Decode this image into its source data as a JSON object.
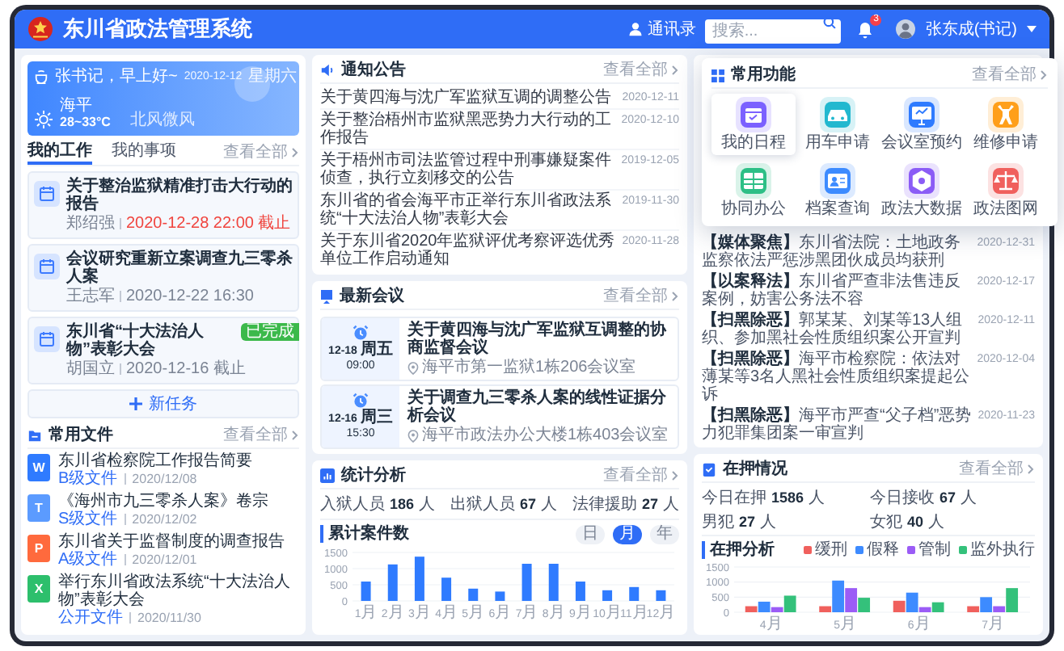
{
  "header": {
    "title": "东川省政法管理系统",
    "contacts": "通讯录",
    "search": {
      "placeholder": "搜索..."
    },
    "notification_count": "3",
    "user": "张东成(书记)"
  },
  "greeting": {
    "text": "张书记，早上好~",
    "city": "海平",
    "temperature": "28~33°C",
    "wind": "北风微风",
    "date": "2020-12-12",
    "weekday": "星期六"
  },
  "work": {
    "tabs": [
      {
        "label": "我的工作",
        "selected": true
      },
      {
        "label": "我的事项",
        "selected": false
      }
    ],
    "view_all": "查看全部",
    "tasks": [
      {
        "title": "关于整治监狱精准打击大行动的报告",
        "person": "郑绍强",
        "time": "2020-12-28 22:00 截止",
        "urgent": true
      },
      {
        "title": "会议研究重新立案调查九三零杀人案",
        "person": "王志军",
        "time": "2020-12-22 16:30",
        "urgent": false
      },
      {
        "title": "东川省“十大法治人物”表彰大会",
        "person": "胡国立",
        "time": "2020-12-16 截止",
        "urgent": false,
        "badge": "已完成"
      }
    ],
    "new_task": "新任务"
  },
  "files": {
    "title": "常用文件",
    "view_all": "查看全部",
    "items": [
      {
        "kind": "word",
        "letter": "W",
        "name": "东川省检察院工作报告简要",
        "grade": "B级文件",
        "date": "2020/12/08"
      },
      {
        "kind": "text",
        "letter": "T",
        "name": "《海州市九三零杀人案》卷宗",
        "grade": "S级文件",
        "date": "2020/12/02"
      },
      {
        "kind": "slides",
        "letter": "P",
        "name": "东川省关于监督制度的调查报告",
        "grade": "A级文件",
        "date": "2020/12/01"
      },
      {
        "kind": "sheet",
        "letter": "X",
        "name": "举行东川省政法系统“十大法治人物”表彰大会",
        "grade": "公开文件",
        "date": "2020/11/30"
      }
    ]
  },
  "notices": {
    "title": "通知公告",
    "view_all": "查看全部",
    "items": [
      {
        "title": "关于黄四海与沈广军监狱互调的调整公告",
        "date": "2020-12-11"
      },
      {
        "title": "关于整治梧州市监狱黑恶势力大行动的工作报告",
        "date": "2020-12-10"
      },
      {
        "title": "关于梧州市司法监管过程中刑事嫌疑案件侦查，执行立刻移交的公告",
        "date": "2019-12-05"
      },
      {
        "title": "东川省的省会海平市正举行东川省政法系统“十大法治人物”表彰大会",
        "date": "2019-11-30"
      },
      {
        "title": "关于东川省2020年监狱评优考察评选优秀单位工作启动通知",
        "date": "2020-11-28"
      }
    ]
  },
  "meetings": {
    "title": "最新会议",
    "view_all": "查看全部",
    "items": [
      {
        "date": "12-18",
        "weekday": "周五",
        "time": "09:00",
        "title": "关于黄四海与沈广军监狱互调整的协商监督会议",
        "location": "海平市第一监狱1栋206会议室"
      },
      {
        "date": "12-16",
        "weekday": "周三",
        "time": "15:30",
        "title": "关于调查九三零杀人案的线性证据分析会议",
        "location": "海平市政法办公大楼1栋403会议室"
      }
    ]
  },
  "stats": {
    "title": "统计分析",
    "view_all": "查看全部",
    "figures": [
      {
        "label": "入狱人员",
        "value": "186",
        "unit": "人"
      },
      {
        "label": "出狱人员",
        "value": "67",
        "unit": "人"
      },
      {
        "label": "法律援助",
        "value": "27",
        "unit": "人"
      }
    ],
    "periods": [
      {
        "label": "日",
        "selected": false
      },
      {
        "label": "月",
        "selected": true
      },
      {
        "label": "年",
        "selected": false
      }
    ],
    "chart_data": {
      "type": "bar",
      "title": "累计案件数",
      "categories": [
        "1月",
        "2月",
        "3月",
        "4月",
        "5月",
        "6月",
        "7月",
        "8月",
        "9月",
        "10月",
        "11月",
        "12月"
      ],
      "series": [
        {
          "color": "#2f7bff",
          "values": [
            600,
            1130,
            1370,
            720,
            380,
            290,
            1150,
            1150,
            600,
            330,
            430,
            330
          ]
        }
      ],
      "ylim": [
        0,
        1500
      ],
      "yticks": [
        0,
        500,
        1000,
        1500
      ]
    }
  },
  "news": {
    "items": [
      {
        "tag": "【媒体聚焦】",
        "title": "东川省法院：土地政务监察依法严惩涉黑团伙成员均获刑",
        "date": "2020-12-31"
      },
      {
        "tag": "【以案释法】",
        "title": "东川省严查非法售违反案例，妨害公务法不容",
        "date": "2020-12-17"
      },
      {
        "tag": "【扫黑除恶】",
        "title": "郭某某、刘某等13人组织、参加黑社会性质组织案公开宣判",
        "date": "2020-12-11"
      },
      {
        "tag": "【扫黑除恶】",
        "title": "海平市检察院：依法对薄某等3名人黑社会性质组织案提起公诉",
        "date": "2020-12-04"
      },
      {
        "tag": "【扫黑除恶】",
        "title": "海平市严查“父子档”恶势力犯罪集团案一审宣判",
        "date": "2020-11-23"
      }
    ]
  },
  "custody": {
    "title": "在押情况",
    "view_all": "查看全部",
    "figures": [
      {
        "label": "今日在押",
        "value": "1586",
        "unit": "人"
      },
      {
        "label": "今日接收",
        "value": "67",
        "unit": "人"
      },
      {
        "label": "男犯",
        "value": "27",
        "unit": "人"
      },
      {
        "label": "女犯",
        "value": "40",
        "unit": "人"
      }
    ],
    "chart_data": {
      "type": "bar",
      "title": "在押分析",
      "categories": [
        "4月",
        "5月",
        "6月",
        "7月"
      ],
      "series": [
        {
          "name": "缓刑",
          "color": "#f0605d",
          "values": [
            200,
            200,
            380,
            200
          ]
        },
        {
          "name": "假释",
          "color": "#3d8bff",
          "values": [
            350,
            1050,
            650,
            500
          ]
        },
        {
          "name": "管制",
          "color": "#9b5cf6",
          "values": [
            170,
            800,
            170,
            200
          ]
        },
        {
          "name": "监外执行",
          "color": "#34c17b",
          "values": [
            550,
            480,
            330,
            800
          ]
        }
      ],
      "ylim": [
        0,
        1500
      ],
      "yticks": [
        0,
        500,
        1000,
        1500
      ]
    }
  },
  "quick_functions": {
    "title": "常用功能",
    "view_all": "查看全部",
    "items": [
      {
        "label": "我的日程",
        "kind": "calendar",
        "color": "#7b61ff",
        "selected": true
      },
      {
        "label": "用车申请",
        "kind": "car",
        "color": "#22b8cf",
        "selected": false
      },
      {
        "label": "会议室预约",
        "kind": "board",
        "color": "#2f7bff",
        "selected": false
      },
      {
        "label": "维修申请",
        "kind": "wrench",
        "color": "#ff9f1a",
        "selected": false
      },
      {
        "label": "协同办公",
        "kind": "sheet",
        "color": "#2dbf86",
        "selected": false
      },
      {
        "label": "档案查询",
        "kind": "card",
        "color": "#3d8bff",
        "selected": false
      },
      {
        "label": "政法大数据",
        "kind": "hexagon",
        "color": "#8b5cf6",
        "selected": false
      },
      {
        "label": "政法图网",
        "kind": "scales",
        "color": "#f0605d",
        "selected": false
      }
    ]
  }
}
